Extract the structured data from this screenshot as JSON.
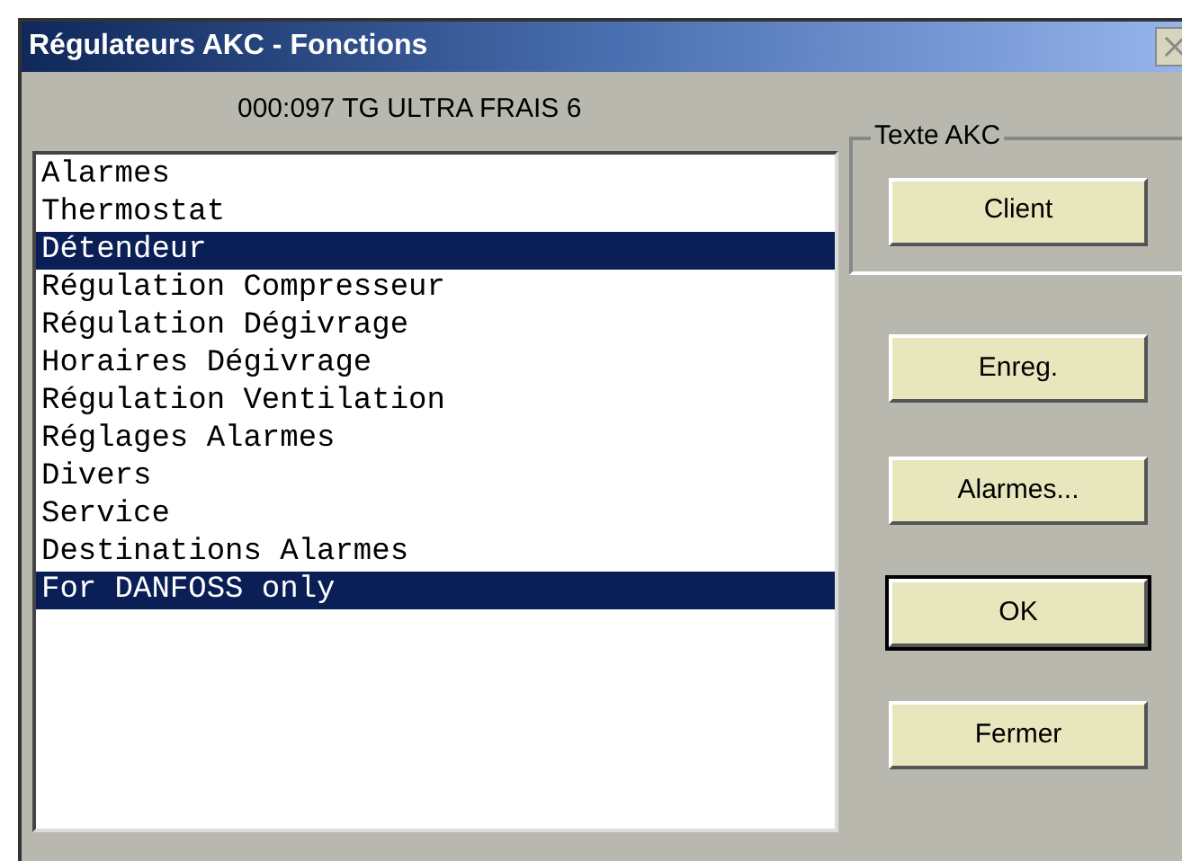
{
  "window": {
    "title": "Régulateurs AKC - Fonctions"
  },
  "device_label": "000:097  TG ULTRA FRAIS 6",
  "functions": [
    {
      "label": "Alarmes",
      "selected": false
    },
    {
      "label": "Thermostat",
      "selected": false
    },
    {
      "label": "Détendeur",
      "selected": true
    },
    {
      "label": "Régulation Compresseur",
      "selected": false
    },
    {
      "label": "Régulation Dégivrage",
      "selected": false
    },
    {
      "label": "Horaires Dégivrage",
      "selected": false
    },
    {
      "label": "Régulation Ventilation",
      "selected": false
    },
    {
      "label": "Réglages Alarmes",
      "selected": false
    },
    {
      "label": "Divers",
      "selected": false
    },
    {
      "label": "Service",
      "selected": false
    },
    {
      "label": "Destinations Alarmes",
      "selected": false
    },
    {
      "label": "For DANFOSS only",
      "selected": true
    }
  ],
  "group": {
    "title": "Texte AKC",
    "button": {
      "label": "Client",
      "default": false
    }
  },
  "buttons": [
    {
      "label": "Enreg.",
      "default": false
    },
    {
      "label": "Alarmes...",
      "default": false
    },
    {
      "label": "OK",
      "default": true
    },
    {
      "label": "Fermer",
      "default": false
    }
  ]
}
